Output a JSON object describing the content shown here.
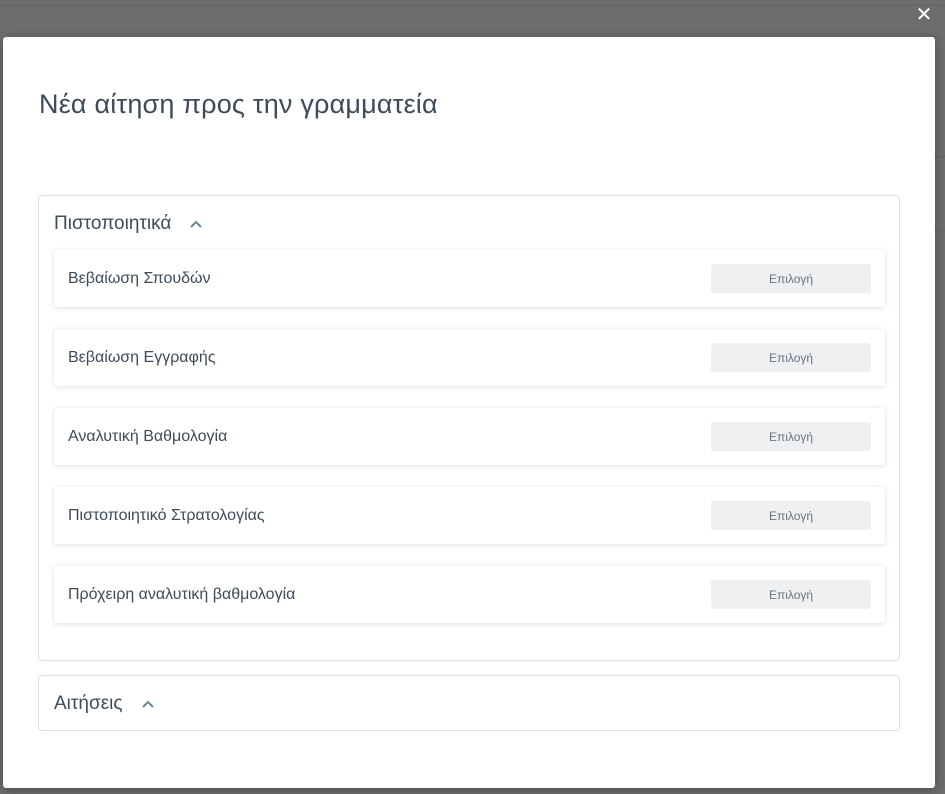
{
  "modal": {
    "title": "Νέα αίτηση προς την γραμματεία",
    "close_icon": "close-icon"
  },
  "sections": [
    {
      "title": "Πιστοποιητικά",
      "expanded": true,
      "items": [
        {
          "label": "Βεβαίωση Σπουδών",
          "button": "Επιλογή"
        },
        {
          "label": "Βεβαίωση Εγγραφής",
          "button": "Επιλογή"
        },
        {
          "label": "Αναλυτική Βαθμολογία",
          "button": "Επιλογή"
        },
        {
          "label": "Πιστοποιητικό Στρατολογίας",
          "button": "Επιλογή"
        },
        {
          "label": "Πρόχειρη αναλυτική βαθμολογία",
          "button": "Επιλογή"
        }
      ]
    },
    {
      "title": "Αιτήσεις",
      "expanded": false,
      "items": []
    }
  ],
  "colors": {
    "title_text": "#3d4b5a",
    "button_bg": "#eef0f2",
    "border": "#dcdfe3"
  }
}
